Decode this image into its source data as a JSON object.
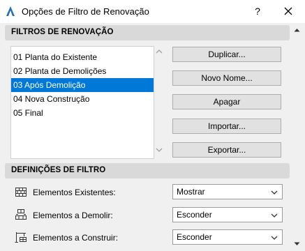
{
  "window": {
    "title": "Opções de Filtro de Renovação",
    "help_label": "?"
  },
  "renovation_filters": {
    "header": "FILTROS DE RENOVAÇÃO",
    "items": [
      {
        "label": "01 Planta do Existente",
        "selected": false
      },
      {
        "label": "02 Planta de Demolições",
        "selected": false
      },
      {
        "label": "03 Após Demolição",
        "selected": true
      },
      {
        "label": "04 Nova Construção",
        "selected": false
      },
      {
        "label": "05 Final",
        "selected": false
      }
    ],
    "buttons": {
      "duplicate": "Duplicar...",
      "new_name": "Novo Nome...",
      "delete": "Apagar",
      "import": "Importar...",
      "export": "Exportar..."
    }
  },
  "filter_settings": {
    "header": "DEFINIÇÕES DE FILTRO",
    "rows": [
      {
        "label": "Elementos Existentes:",
        "icon": "brick-wall-icon",
        "value": "Mostrar"
      },
      {
        "label": "Elementos a Demolir:",
        "icon": "demolish-icon",
        "value": "Esconder"
      },
      {
        "label": "Elementos a Construir:",
        "icon": "construct-icon",
        "value": "Esconder"
      }
    ]
  },
  "colors": {
    "selection": "#0078d7",
    "section_header_bg": "#d9d9d9",
    "button_bg": "#e1e1e1",
    "window_bg": "#f0f0f0"
  }
}
